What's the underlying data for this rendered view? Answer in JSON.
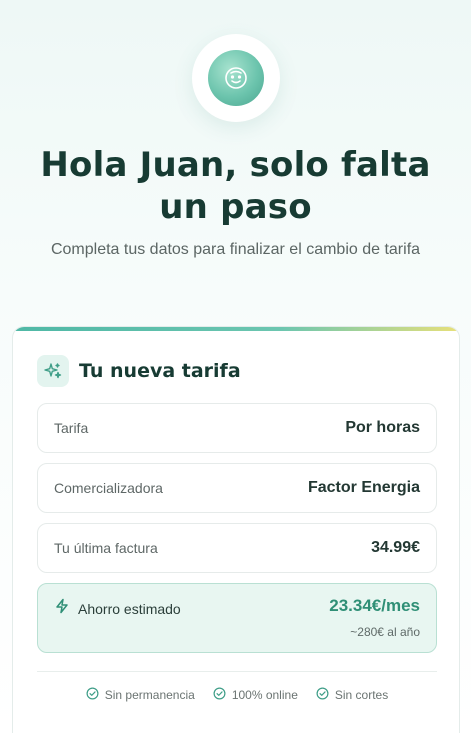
{
  "hero": {
    "avatar_icon": "smiley-face-icon",
    "title": "Hola Juan, solo falta un paso",
    "subtitle": "Completa tus datos para finalizar el cambio de tarifa"
  },
  "card": {
    "header_icon": "sparkles-icon",
    "title": "Tu nueva tarifa",
    "rows": [
      {
        "label": "Tarifa",
        "value": "Por horas"
      },
      {
        "label": "Comercializadora",
        "value": "Factor Energia"
      },
      {
        "label": "Tu última factura",
        "value": "34.99€"
      }
    ],
    "savings": {
      "icon": "lightning-icon",
      "label": "Ahorro estimado",
      "value": "23.34€/mes",
      "sub": "~280€ al año"
    },
    "perks": [
      {
        "icon": "check-circle-icon",
        "label": "Sin permanencia"
      },
      {
        "icon": "check-circle-icon",
        "label": "100% online"
      },
      {
        "icon": "check-circle-icon",
        "label": "Sin cortes"
      }
    ]
  },
  "colors": {
    "brand": "#4fb8a6",
    "title": "#173b33",
    "savings_accent": "#2f8f76",
    "savings_bg": "#e8f6f1"
  }
}
